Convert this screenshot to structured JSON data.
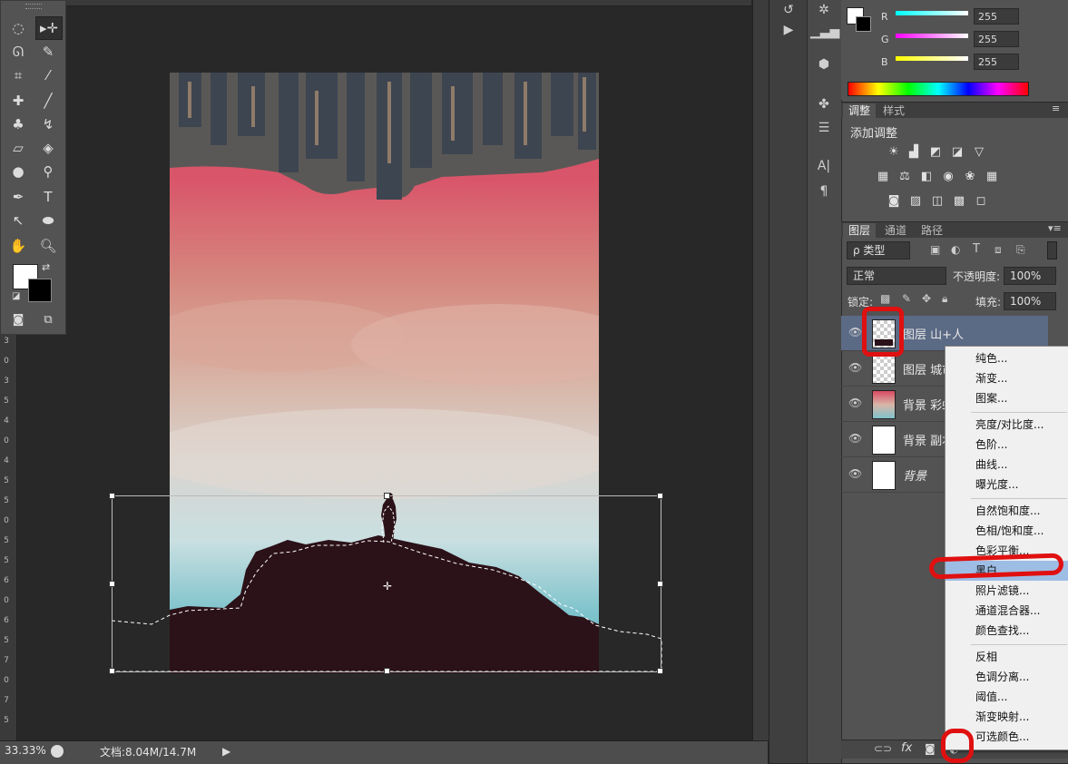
{
  "status": {
    "zoom": "33.33%",
    "doc_info": "文档:8.04M/14.7M"
  },
  "ruler_left_ticks": [
    "3",
    "0",
    "3",
    "5",
    "4",
    "0",
    "4",
    "5",
    "5",
    "0",
    "5",
    "5",
    "6",
    "0",
    "6",
    "5",
    "7",
    "0",
    "7",
    "5"
  ],
  "color_panel": {
    "labels": [
      "R",
      "G",
      "B"
    ],
    "values": [
      "255",
      "255",
      "255"
    ],
    "slider_colors": [
      "#5ff",
      "#f5f",
      "#ff3"
    ]
  },
  "adjust_panel": {
    "tabs": [
      "调整",
      "样式"
    ],
    "title": "添加调整"
  },
  "layers_panel": {
    "tabs": [
      "图层",
      "通道",
      "路径"
    ],
    "filter_kind": "ρ 类型",
    "blend_mode": "正常",
    "opacity_label": "不透明度:",
    "opacity_value": "100%",
    "lock_label": "锁定:",
    "fill_label": "填充:",
    "fill_value": "100%",
    "layers": [
      {
        "name": "图层 山+人"
      },
      {
        "name": "图层 城市"
      },
      {
        "name": "背景 彩虹"
      },
      {
        "name": "背景 副本"
      },
      {
        "name": "背景"
      }
    ]
  },
  "adjust_menu": {
    "items": [
      "纯色...",
      "渐变...",
      "图案...",
      "亮度/对比度...",
      "色阶...",
      "曲线...",
      "曝光度...",
      "自然饱和度...",
      "色相/饱和度...",
      "色彩平衡...",
      "黑白...",
      "照片滤镜...",
      "通道混合器...",
      "颜色查找...",
      "反相",
      "色调分离...",
      "阈值...",
      "渐变映射...",
      "可选颜色..."
    ],
    "hovered": "黑白..."
  }
}
